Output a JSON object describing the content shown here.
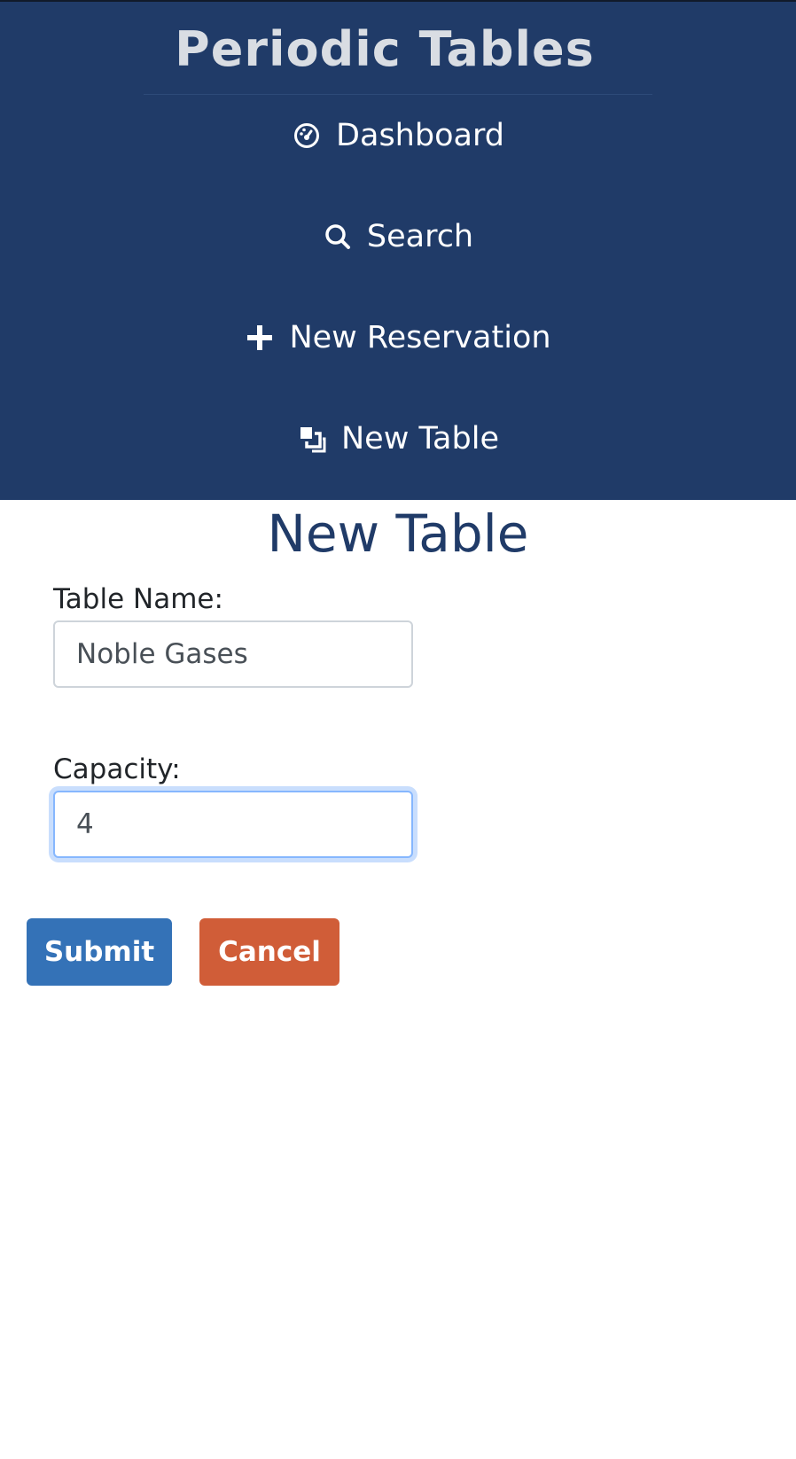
{
  "app": {
    "brand": "Periodic Tables"
  },
  "nav": {
    "items": [
      {
        "label": "Dashboard",
        "icon": "dashboard-icon"
      },
      {
        "label": "Search",
        "icon": "search-icon"
      },
      {
        "label": "New Reservation",
        "icon": "plus-icon"
      },
      {
        "label": "New Table",
        "icon": "layers-icon"
      }
    ]
  },
  "page": {
    "title": "New Table"
  },
  "form": {
    "table_name": {
      "label": "Table Name:",
      "value": "Noble Gases"
    },
    "capacity": {
      "label": "Capacity:",
      "value": "4"
    },
    "submit_label": "Submit",
    "cancel_label": "Cancel"
  },
  "colors": {
    "nav_bg": "#203b68",
    "title": "#203b68",
    "submit": "#3472b7",
    "cancel": "#d05d38"
  }
}
